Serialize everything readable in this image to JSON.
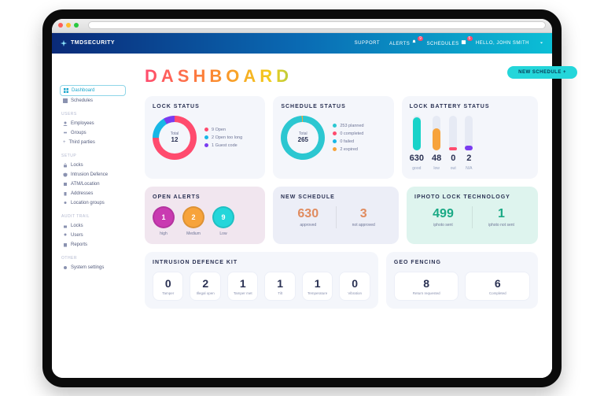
{
  "browser": {
    "dots": [
      "#ff5f57",
      "#febc2e",
      "#28c840"
    ]
  },
  "brand": "TMDSECURITY",
  "nav": {
    "support": "SUPPORT",
    "alerts": "ALERTS",
    "alerts_badge": "9",
    "schedules": "SCHEDULES",
    "schedules_badge": "5",
    "greeting": "HELLO, JOHN SMITH"
  },
  "sidebar": {
    "dashboard": "Dashboard",
    "schedules": "Schedules",
    "groups": {
      "users_head": "USERS",
      "employees": "Employees",
      "groups": "Groups",
      "third_parties": "Third parties",
      "setup_head": "SETUP",
      "locks": "Locks",
      "intrusion_defence": "Intrusion Defence",
      "atm_location": "ATM/Location",
      "addresses": "Addresses",
      "location_groups": "Location groups",
      "audit_head": "AUDIT TRAIL",
      "a_locks": "Locks",
      "a_users": "Users",
      "a_reports": "Reports",
      "other_head": "OTHER",
      "system_settings": "System settings"
    }
  },
  "page": {
    "title": "DASHBOARD",
    "new_schedule_btn": "NEW SCHEDULE  +"
  },
  "lock_status": {
    "title": "LOCK STATUS",
    "center_label": "Total",
    "center_value": "12",
    "legend": [
      {
        "color": "#ff4b6e",
        "text": "9 Open"
      },
      {
        "color": "#18b7e6",
        "text": "2 Open too long"
      },
      {
        "color": "#7a3cf0",
        "text": "1 Guest code"
      }
    ]
  },
  "schedule_status": {
    "title": "SCHEDULE STATUS",
    "center_label": "Total",
    "center_value": "265",
    "legend": [
      {
        "color": "#2cc7d1",
        "text": "253 planned"
      },
      {
        "color": "#ff4b6e",
        "text": "0 completed"
      },
      {
        "color": "#18b7e6",
        "text": "0 failed"
      },
      {
        "color": "#f7a33b",
        "text": "2 expired"
      }
    ]
  },
  "battery": {
    "title": "LOCK BATTERY STATUS",
    "cols": [
      {
        "num": "630",
        "label": "good",
        "color": "#18d3c9",
        "h": 42
      },
      {
        "num": "48",
        "label": "low",
        "color": "#f7a33b",
        "h": 28
      },
      {
        "num": "0",
        "label": "out",
        "color": "#ff4b6e",
        "h": 4
      },
      {
        "num": "2",
        "label": "N/A",
        "color": "#7a3cf0",
        "h": 6
      }
    ]
  },
  "alerts": {
    "title": "OPEN ALERTS",
    "items": [
      {
        "n": "1",
        "label": "high",
        "color": "#c93ab1"
      },
      {
        "n": "2",
        "label": "Medium",
        "color": "#f7a33b"
      },
      {
        "n": "9",
        "label": "Low",
        "color": "#24d6da"
      }
    ]
  },
  "new_schedule": {
    "title": "NEW SCHEDULE",
    "approved_n": "630",
    "approved_l": "approved",
    "not_n": "3",
    "not_l": "not approved",
    "accent": "#e08b5f"
  },
  "iphoto": {
    "title": "IPHOTO LOCK TECHNOLOGY",
    "sent_n": "499",
    "sent_l": "iphoto sent",
    "not_n": "1",
    "not_l": "iphoto not sent",
    "accent": "#1aa985"
  },
  "idk": {
    "title": "INTRUSION DEFENCE KIT",
    "items": [
      {
        "n": "0",
        "l": "Tamper"
      },
      {
        "n": "2",
        "l": "Illegal open"
      },
      {
        "n": "1",
        "l": "Tamper met"
      },
      {
        "n": "1",
        "l": "Tilt"
      },
      {
        "n": "1",
        "l": "Temperature"
      },
      {
        "n": "0",
        "l": "Vibration"
      }
    ]
  },
  "geo": {
    "title": "GEO FENCING",
    "items": [
      {
        "n": "8",
        "l": "Return requested"
      },
      {
        "n": "6",
        "l": "Completed"
      }
    ]
  },
  "chart_data": [
    {
      "type": "pie",
      "title": "LOCK STATUS",
      "categories": [
        "Open",
        "Open too long",
        "Guest code"
      ],
      "values": [
        9,
        2,
        1
      ],
      "colors": [
        "#ff4b6e",
        "#18b7e6",
        "#7a3cf0"
      ],
      "total": 12
    },
    {
      "type": "pie",
      "title": "SCHEDULE STATUS",
      "categories": [
        "planned",
        "completed",
        "failed",
        "expired"
      ],
      "values": [
        253,
        0,
        0,
        2
      ],
      "colors": [
        "#2cc7d1",
        "#ff4b6e",
        "#18b7e6",
        "#f7a33b"
      ],
      "total": 265
    },
    {
      "type": "bar",
      "title": "LOCK BATTERY STATUS",
      "categories": [
        "good",
        "low",
        "out",
        "N/A"
      ],
      "values": [
        630,
        48,
        0,
        2
      ],
      "colors": [
        "#18d3c9",
        "#f7a33b",
        "#ff4b6e",
        "#7a3cf0"
      ]
    }
  ]
}
